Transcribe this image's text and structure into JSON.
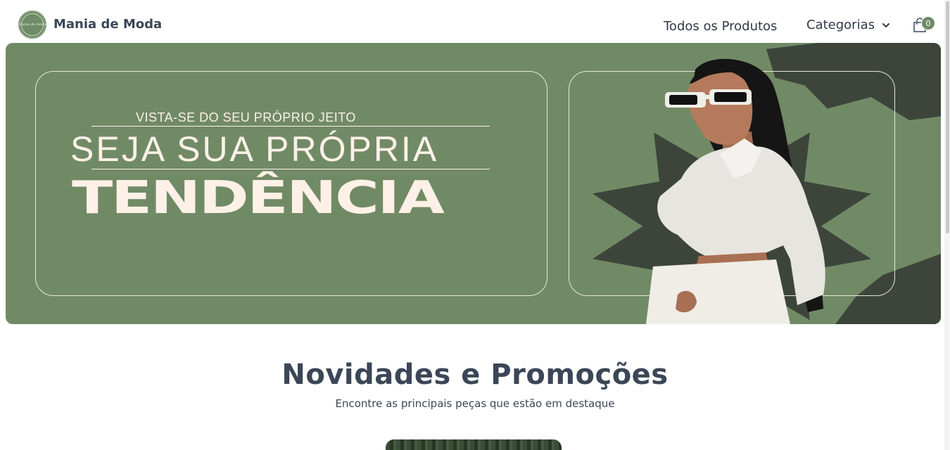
{
  "header": {
    "logo_script": "Mania de moda",
    "brand": "Mania de Moda",
    "nav_all_products": "Todos os Produtos",
    "nav_categories": "Categorias",
    "cart_count": "0"
  },
  "hero": {
    "tagline": "VISTA-SE DO SEU PRÓPRIO JEITO",
    "headline": "SEJA SUA PRÓPRIA",
    "big_word": "TENDÊNCIA"
  },
  "section": {
    "title": "Novidades e Promoções",
    "subtitle": "Encontre as principais peças que estão em destaque"
  },
  "colors": {
    "brand_green": "#718a66",
    "dark_accent": "#3d453b",
    "cream_text": "#fdf1e7",
    "heading_text": "#3b4656"
  },
  "icons": {
    "categories_chevron": "chevron-down-icon",
    "cart": "shopping-bag-icon"
  }
}
